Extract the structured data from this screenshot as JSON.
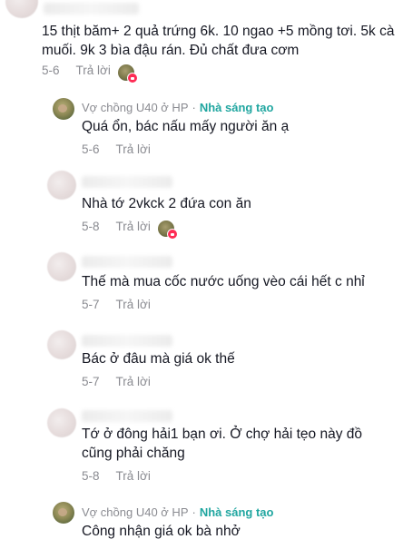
{
  "comments": [
    {
      "text": "15 thịt băm+ 2 quả trứng 6k. 10 ngao +5 mồng tơi. 5k cà muối. 9k 3 bìa đậu rán. Đủ chất đưa cơm",
      "date": "5-6",
      "reply_label": "Trả lời",
      "liked_by_creator": true
    },
    {
      "author": "Vợ chồng U40 ở HP",
      "separator": "·",
      "badge": "Nhà sáng tạo",
      "text": "Quá ổn, bác nấu mấy người ăn ạ",
      "date": "5-6",
      "reply_label": "Trả lời"
    },
    {
      "text": "Nhà tớ 2vkck 2 đứa con ăn",
      "date": "5-8",
      "reply_label": "Trả lời",
      "liked_by_creator": true
    },
    {
      "text": "Thế mà mua cốc nước uống vèo cái hết c nhỉ",
      "date": "5-7",
      "reply_label": "Trả lời"
    },
    {
      "text": "Bác ở đâu mà giá ok thế",
      "date": "5-7",
      "reply_label": "Trả lời"
    },
    {
      "text": "Tớ ở đông hải1 bạn ơi. Ở chợ hải tẹo này đồ cũng phải chăng",
      "date": "5-8",
      "reply_label": "Trả lời"
    },
    {
      "author": "Vợ chồng U40 ở HP",
      "separator": "·",
      "badge": "Nhà sáng tạo",
      "text": "Công nhận giá ok bà nhở"
    }
  ],
  "colors": {
    "text": "#161823",
    "muted": "#8a8b91",
    "creator_badge": "#20a6a0",
    "like_heart": "#fe2c55"
  }
}
